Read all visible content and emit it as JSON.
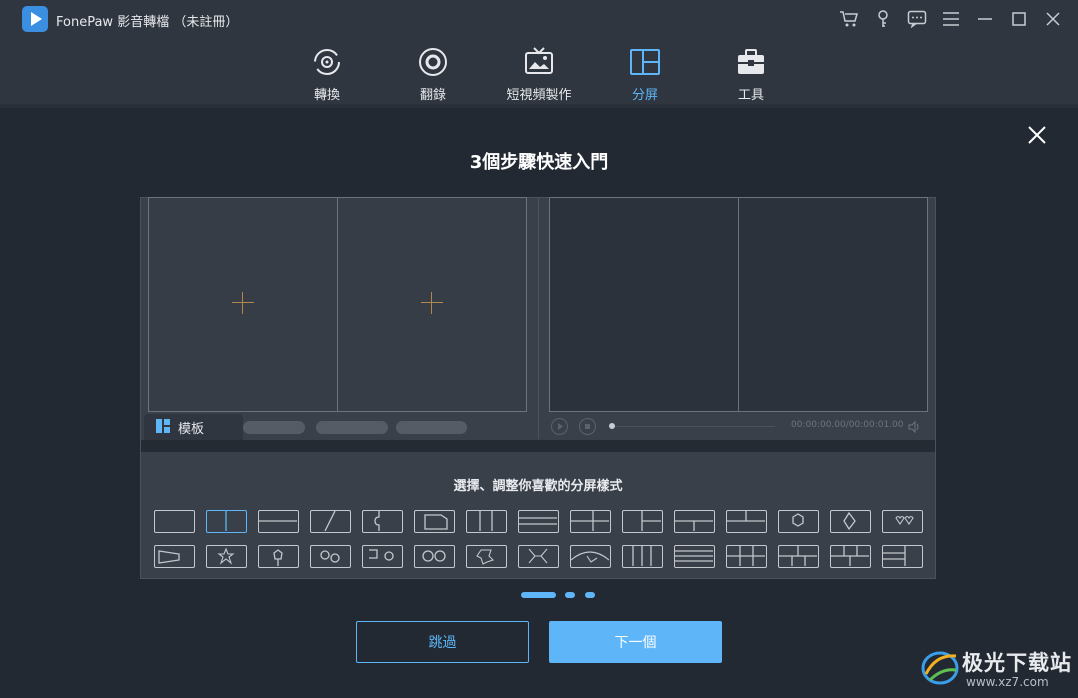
{
  "app": {
    "title": "FonePaw 影音轉檔 （未註冊）"
  },
  "window_controls": [
    {
      "name": "cart-icon"
    },
    {
      "name": "key-icon"
    },
    {
      "name": "feedback-icon"
    },
    {
      "name": "menu-icon"
    },
    {
      "name": "minimize-icon"
    },
    {
      "name": "maximize-icon"
    },
    {
      "name": "close-icon"
    }
  ],
  "nav": {
    "items": [
      {
        "label": "轉換",
        "icon": "convert-icon",
        "active": false
      },
      {
        "label": "翻錄",
        "icon": "disc-icon",
        "active": false
      },
      {
        "label": "短視頻製作",
        "icon": "tv-icon",
        "active": false
      },
      {
        "label": "分屏",
        "icon": "split-screen-icon",
        "active": true
      },
      {
        "label": "工具",
        "icon": "toolbox-icon",
        "active": false
      }
    ]
  },
  "guide": {
    "title": "3個步驟快速入門",
    "template_tab": "模板",
    "timecode": "00:00:00.00/00:00:01.00",
    "panel_title": "選擇、調整你喜歡的分屏樣式",
    "selected_layout_index": 1,
    "page_count": 3,
    "active_page": 1,
    "skip_label": "跳過",
    "next_label": "下一個"
  },
  "watermark": {
    "text": "极光下载站",
    "url": "www.xz7.com"
  },
  "colors": {
    "accent": "#5eb5f7",
    "background": "#222933",
    "titlebar": "#30363f",
    "panel": "#39404a",
    "plus": "#b0884a"
  }
}
